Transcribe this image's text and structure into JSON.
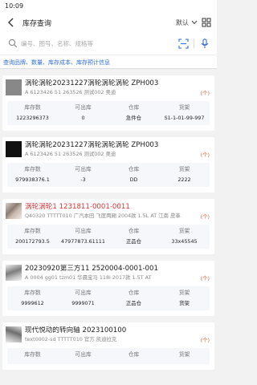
{
  "status": {
    "time": "10:09"
  },
  "header": {
    "title": "库存查询",
    "sort_label": "默认"
  },
  "search": {
    "placeholder": "编号、图号、名称、规格等"
  },
  "links": "查询品牌、数量、库存成本、库存预计信息",
  "columns": [
    "库存数",
    "可出库",
    "仓库",
    "货架"
  ],
  "items": [
    {
      "name": "涡轮涡轮20231227涡轮涡轮涡轮 ZPH003",
      "sub": "A 6123426 51 263526 测试002 奥迪",
      "badge": "(个)",
      "values": [
        "1223296373",
        "0",
        "急件仓",
        "S1-1-01-99-997"
      ]
    },
    {
      "name": "涡轮涡轮20231227涡轮涡轮涡轮 ZPH003",
      "sub": "A 6123426 51 263526 测试002 奥迪",
      "badge": "(个)",
      "values": [
        "979938376.1",
        "-3",
        "DD",
        "2222"
      ]
    },
    {
      "name": "涡轮涡轮1 1231811-0001-0011",
      "sub": "Q40320 TTTTT010 广汽本田 飞度两厢 2004款 1.5L AT 江南 皮革",
      "badge": "(个)",
      "values": [
        "200172793.5",
        "47977873.61111",
        "正品仓",
        "33x45545"
      ]
    },
    {
      "name": "20230920第三方11 2520004-0001-001",
      "sub": "A 0004 gg01 tzm01 华晨宝马 118i 2017款 1.5T AT",
      "badge": "(个)",
      "values": [
        "9999612",
        "9999071",
        "正品仓",
        "货架"
      ]
    },
    {
      "name": "现代悦动的转向轴 2023100100",
      "sub": "text0002-sd TTTTT010 官方 凯迪拉克",
      "badge": "(个)",
      "values": [
        "",
        "",
        "",
        ""
      ]
    }
  ],
  "colors": {
    "accent": "#2f6fd8",
    "red": "#d33",
    "badge": "#e05a3a"
  }
}
